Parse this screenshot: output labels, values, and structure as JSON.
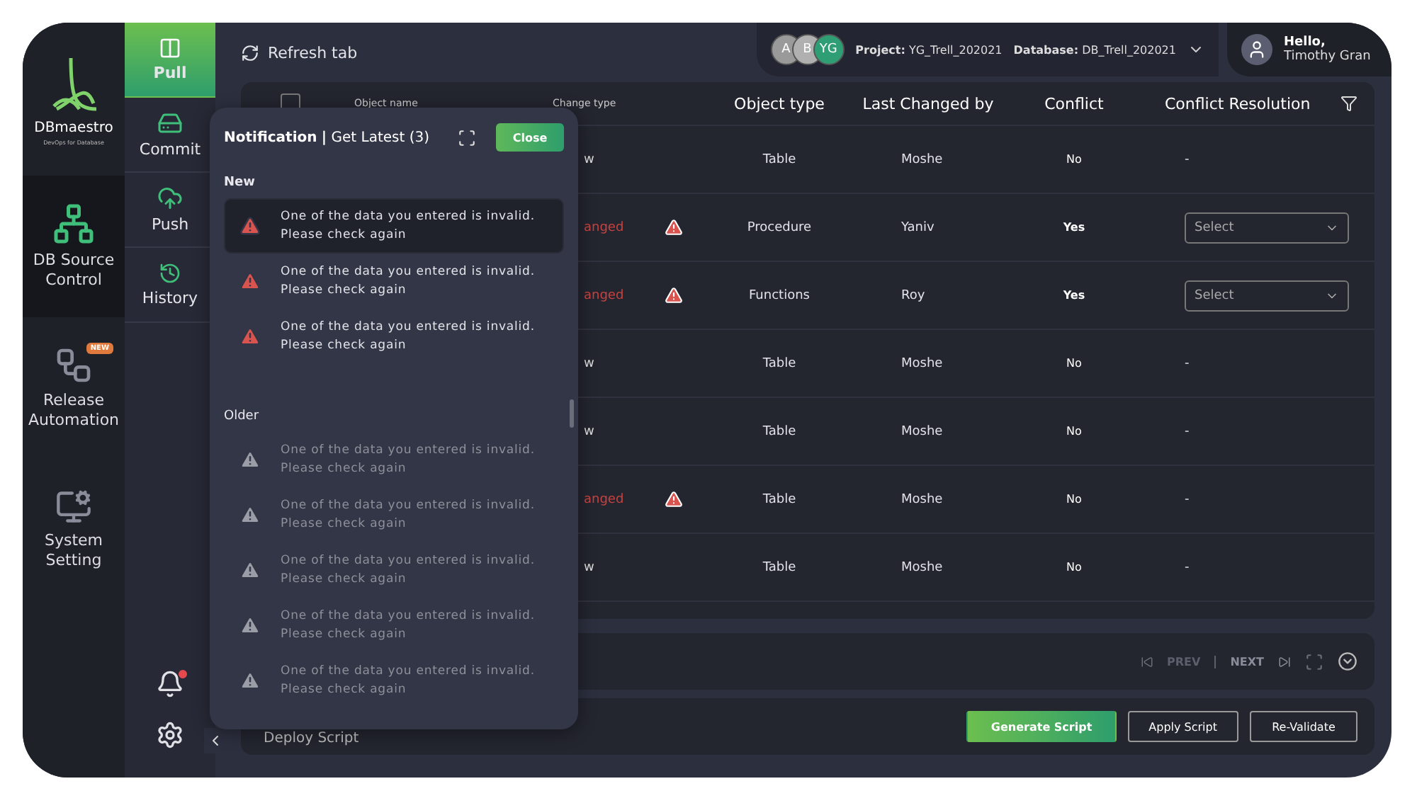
{
  "nav": {
    "logo": {
      "name": "DBmaestro",
      "tagline": "DevOps for Database"
    },
    "items": [
      {
        "kind": "source",
        "label": "DB Source Control",
        "selected": true
      },
      {
        "kind": "release",
        "label": "Release Automation",
        "selected": false,
        "badge": "NEW"
      },
      {
        "kind": "setting",
        "label": "System Setting",
        "selected": false
      }
    ]
  },
  "subnav": [
    {
      "kind": "pull",
      "label": "Pull",
      "selected": true
    },
    {
      "kind": "commit",
      "label": "Commit",
      "selected": false
    },
    {
      "kind": "push",
      "label": "Push",
      "selected": false
    },
    {
      "kind": "history",
      "label": "History",
      "selected": false
    }
  ],
  "topbar": {
    "refresh": "Refresh tab",
    "avatars": [
      {
        "initials": "A",
        "color": "#9a9a9a"
      },
      {
        "initials": "B",
        "color": "#b0b0b0"
      },
      {
        "initials": "YG",
        "color": "#2f9e74"
      }
    ],
    "project_label": "Project:",
    "project": "YG_Trell_202021",
    "database_label": "Database:",
    "database": "DB_Trell_202021",
    "greeting": "Hello,",
    "user": "Timothy Gran"
  },
  "table": {
    "select_all": {
      "checked": false
    },
    "columns": [
      "Object name",
      "Change type",
      "Object type",
      "Last Changed by",
      "Conflict",
      "Conflict Resolution"
    ],
    "rows": [
      {
        "change_type": "w",
        "kind": "new",
        "warning": false,
        "object_type": "Table",
        "changed_by": "Moshe",
        "conflict": "No",
        "resolution": {
          "kind": "text",
          "text": "-"
        }
      },
      {
        "change_type": "anged",
        "kind": "changed",
        "warning": true,
        "object_type": "Procedure",
        "changed_by": "Yaniv",
        "conflict": "Yes",
        "resolution": {
          "kind": "select",
          "text": "Select"
        }
      },
      {
        "change_type": "anged",
        "kind": "changed",
        "warning": true,
        "object_type": "Functions",
        "changed_by": "Roy",
        "conflict": "Yes",
        "resolution": {
          "kind": "select",
          "text": "Select"
        }
      },
      {
        "change_type": "w",
        "kind": "new",
        "warning": false,
        "object_type": "Table",
        "changed_by": "Moshe",
        "conflict": "No",
        "resolution": {
          "kind": "text",
          "text": "-"
        }
      },
      {
        "change_type": "w",
        "kind": "new",
        "warning": false,
        "object_type": "Table",
        "changed_by": "Moshe",
        "conflict": "No",
        "resolution": {
          "kind": "text",
          "text": "-"
        }
      },
      {
        "change_type": "anged",
        "kind": "changed",
        "warning": true,
        "object_type": "Table",
        "changed_by": "Moshe",
        "conflict": "No",
        "resolution": {
          "kind": "text",
          "text": "-"
        }
      },
      {
        "change_type": "w",
        "kind": "new",
        "warning": false,
        "object_type": "Table",
        "changed_by": "Moshe",
        "conflict": "No",
        "resolution": {
          "kind": "text",
          "text": "-"
        }
      }
    ]
  },
  "pagination": {
    "prev": "PREV",
    "next": "NEXT"
  },
  "actions": {
    "label": "Deploy Script",
    "buttons": [
      {
        "label": "Generate Script",
        "kind": "primary"
      },
      {
        "label": "Apply Script",
        "kind": "outline"
      },
      {
        "label": "Re-Validate",
        "kind": "outline"
      }
    ]
  },
  "notification": {
    "title": "Notification",
    "separator": "|",
    "subtitle": "Get Latest (3)",
    "close": "Close",
    "sections": [
      {
        "title": "New",
        "kind": "new",
        "items": [
          {
            "text": "One of the data you entered is invalid.\nPlease check again",
            "selected": true
          },
          {
            "text": "One of the data you entered is invalid.\nPlease check again",
            "selected": false
          },
          {
            "text": "One of the data you entered is invalid.\nPlease check again",
            "selected": false
          }
        ]
      },
      {
        "title": "Older",
        "kind": "older",
        "items": [
          {
            "text": "One of the data you entered is invalid.\nPlease check again",
            "selected": false
          },
          {
            "text": "One of the data you entered is invalid.\nPlease check again",
            "selected": false
          },
          {
            "text": "One of the data you entered is invalid.\nPlease check again",
            "selected": false
          },
          {
            "text": "One of the data you entered is invalid.\nPlease check again",
            "selected": false
          },
          {
            "text": "One of the data you entered is invalid.\nPlease check again",
            "selected": false
          }
        ]
      }
    ]
  }
}
